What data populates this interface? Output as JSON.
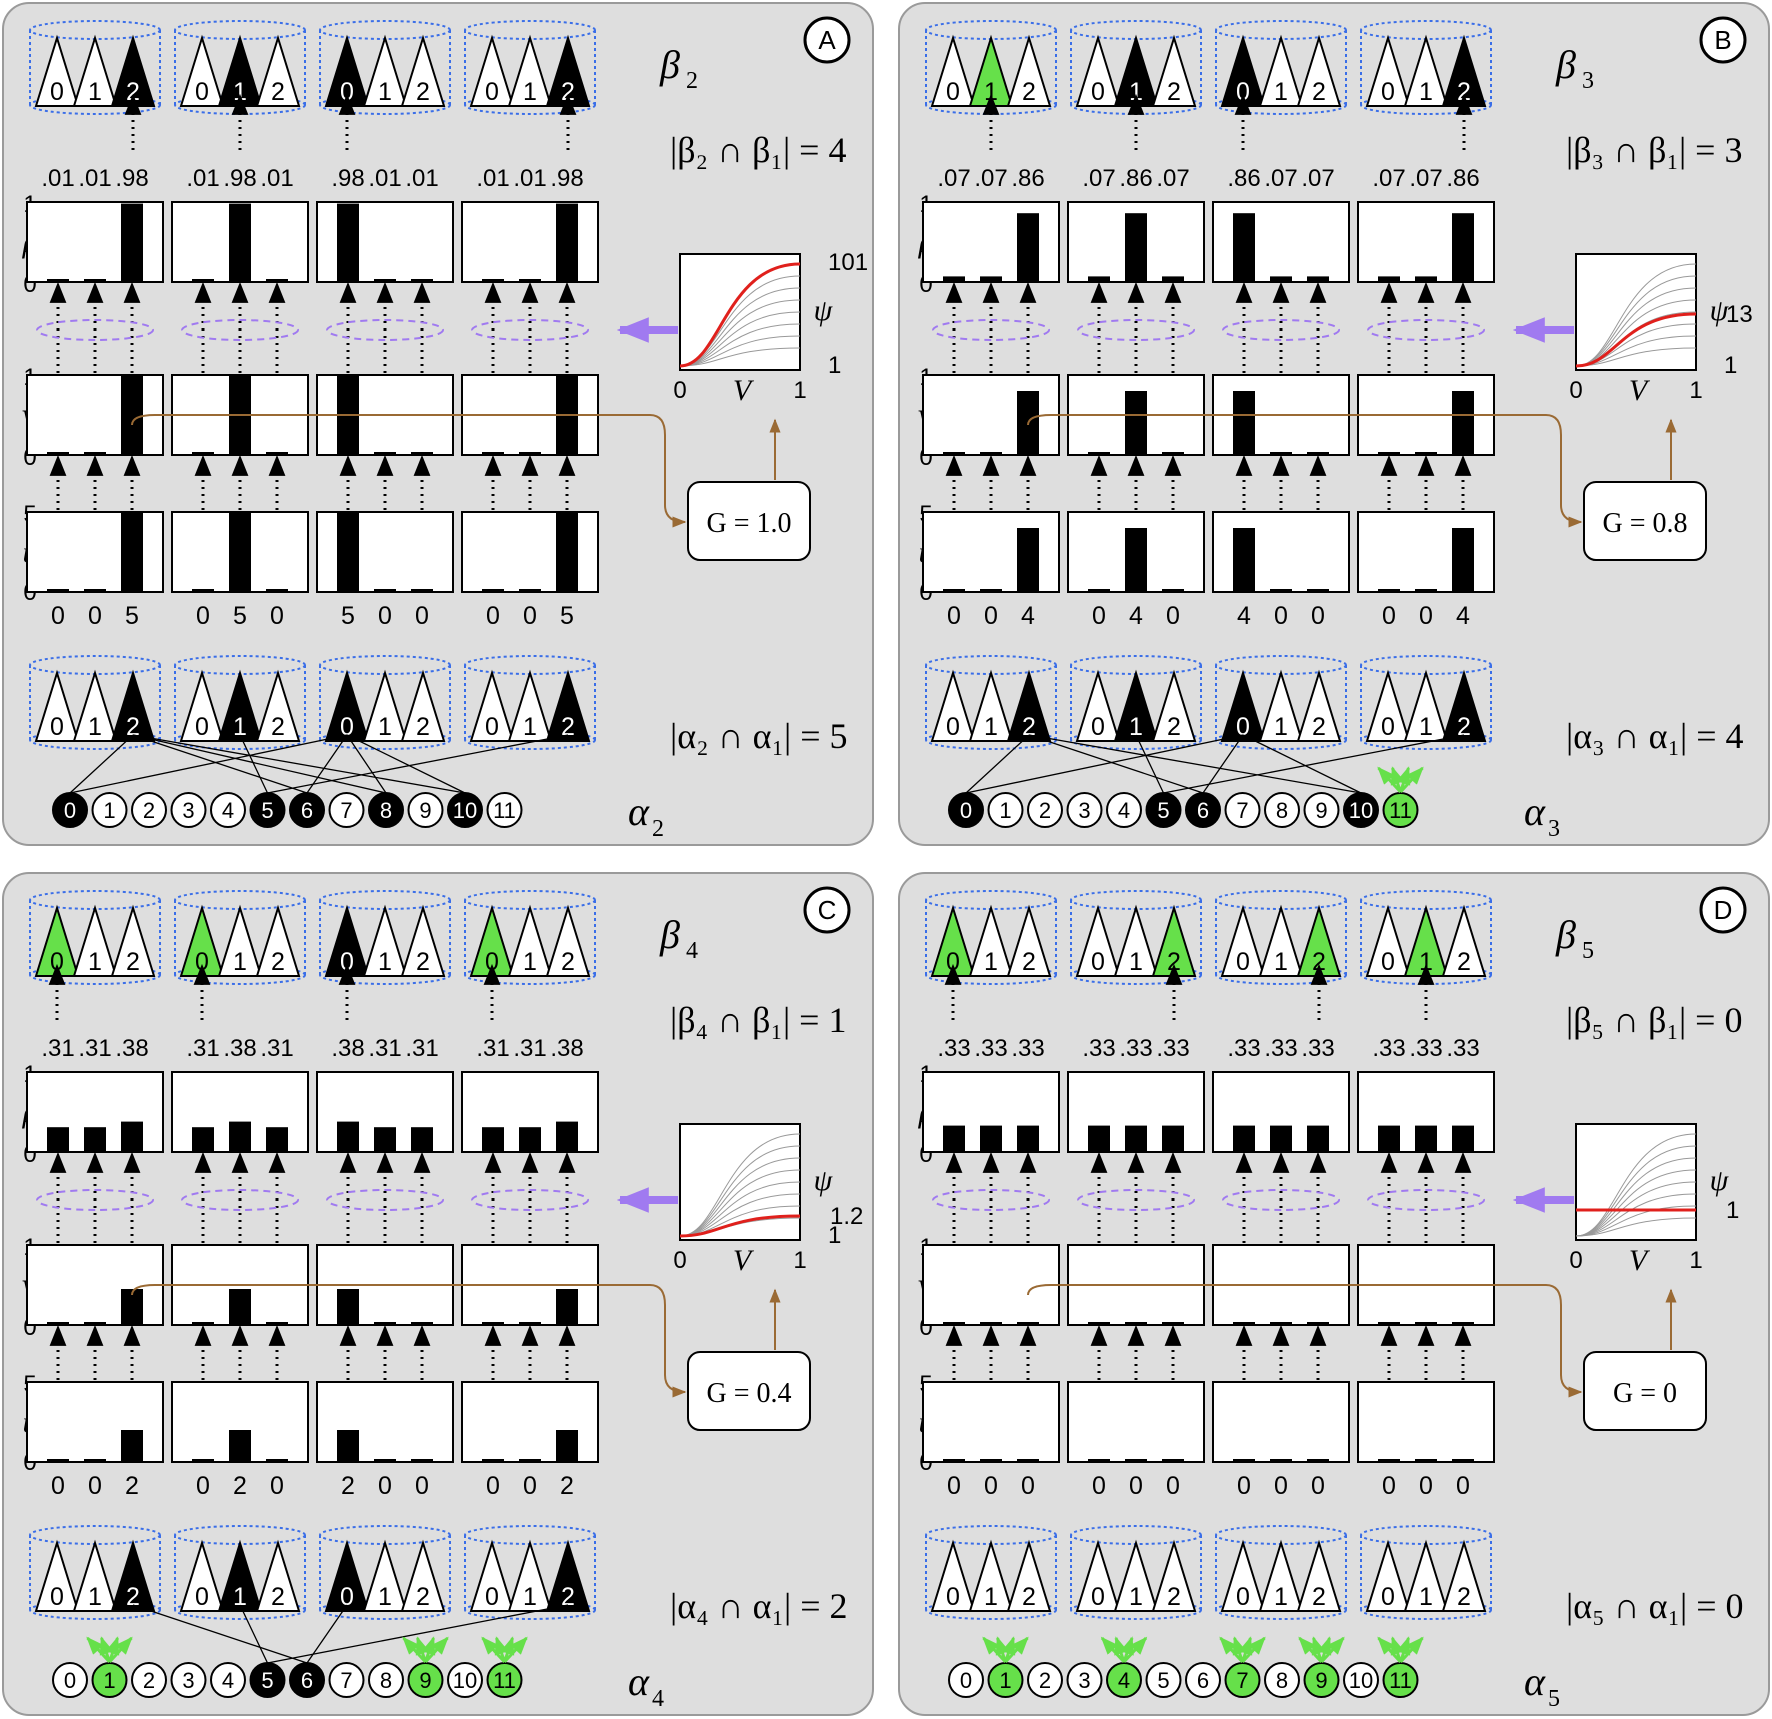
{
  "colors": {
    "panel": "#dedede",
    "green": "#66e04a",
    "purple": "#a07af0",
    "brown": "#9a6a34",
    "blue": "#3a6ee8",
    "red": "#e0201c"
  },
  "axis_labels": {
    "rho": "ρ",
    "V": "V",
    "u": "u",
    "psi": "ψ",
    "x0": "0",
    "x1": "1",
    "t0": "0",
    "t1": "1",
    "t5": "5"
  },
  "neuron_labels": [
    "0",
    "1",
    "2",
    "3",
    "4",
    "5",
    "6",
    "7",
    "8",
    "9",
    "10",
    "11"
  ],
  "triangle_labels": [
    "0",
    "1",
    "2"
  ],
  "panels": [
    {
      "letter": "A",
      "beta_sym": "β",
      "beta_sub": "2",
      "beta_overlap": "|β₂ ∩ β₁| = 4",
      "alpha_sym": "α",
      "alpha_sub": "2",
      "alpha_overlap": "|α₂ ∩ α₁| = 5",
      "G_label": "G = 1.0",
      "psi_top": "101",
      "psi_bottom": "1",
      "psi_mid": "",
      "winners": [
        2,
        1,
        0,
        2
      ],
      "top_green": [
        false,
        false,
        false,
        false
      ],
      "bottom_black": [
        true,
        true,
        true,
        true
      ],
      "rho": [
        [
          0.01,
          0.01,
          0.98
        ],
        [
          0.01,
          0.98,
          0.01
        ],
        [
          0.98,
          0.01,
          0.01
        ],
        [
          0.01,
          0.01,
          0.98
        ]
      ],
      "rho_labels": [
        ".01",
        ".01",
        ".98",
        ".01",
        ".98",
        ".01",
        ".98",
        ".01",
        ".01",
        ".01",
        ".01",
        ".98"
      ],
      "V": [
        [
          0,
          0,
          1.0
        ],
        [
          0,
          1.0,
          0
        ],
        [
          1.0,
          0,
          0
        ],
        [
          0,
          0,
          1.0
        ]
      ],
      "u": [
        [
          0,
          0,
          5
        ],
        [
          0,
          5,
          0
        ],
        [
          5,
          0,
          0
        ],
        [
          0,
          0,
          5
        ]
      ],
      "u_labels": [
        "0",
        "0",
        "5",
        "0",
        "5",
        "0",
        "5",
        "0",
        "0",
        "0",
        "0",
        "5"
      ],
      "black_neurons": [
        0,
        5,
        6,
        8,
        10
      ],
      "green_neurons": []
    },
    {
      "letter": "B",
      "beta_sym": "β",
      "beta_sub": "3",
      "beta_overlap": "|β₃ ∩ β₁| = 3",
      "alpha_sym": "α",
      "alpha_sub": "3",
      "alpha_overlap": "|α₃ ∩ α₁| = 4",
      "G_label": "G = 0.8",
      "psi_top": "",
      "psi_bottom": "1",
      "psi_mid": "13",
      "winners": [
        1,
        1,
        0,
        2
      ],
      "top_green": [
        true,
        false,
        false,
        false
      ],
      "bottom_black": [
        true,
        true,
        true,
        true
      ],
      "rho": [
        [
          0.07,
          0.07,
          0.86
        ],
        [
          0.07,
          0.86,
          0.07
        ],
        [
          0.86,
          0.07,
          0.07
        ],
        [
          0.07,
          0.07,
          0.86
        ]
      ],
      "rho_labels": [
        ".07",
        ".07",
        ".86",
        ".07",
        ".86",
        ".07",
        ".86",
        ".07",
        ".07",
        ".07",
        ".07",
        ".86"
      ],
      "V": [
        [
          0,
          0,
          0.8
        ],
        [
          0,
          0.8,
          0
        ],
        [
          0.8,
          0,
          0
        ],
        [
          0,
          0,
          0.8
        ]
      ],
      "u": [
        [
          0,
          0,
          4
        ],
        [
          0,
          4,
          0
        ],
        [
          4,
          0,
          0
        ],
        [
          0,
          0,
          4
        ]
      ],
      "u_labels": [
        "0",
        "0",
        "4",
        "0",
        "4",
        "0",
        "4",
        "0",
        "0",
        "0",
        "0",
        "4"
      ],
      "black_neurons": [
        0,
        5,
        6,
        10
      ],
      "green_neurons": [
        11
      ]
    },
    {
      "letter": "C",
      "beta_sym": "β",
      "beta_sub": "4",
      "beta_overlap": "|β₄ ∩ β₁| = 1",
      "alpha_sym": "α",
      "alpha_sub": "4",
      "alpha_overlap": "|α₄ ∩ α₁| = 2",
      "G_label": "G = 0.4",
      "psi_top": "",
      "psi_bottom": "1",
      "psi_mid": "1.2",
      "winners": [
        0,
        0,
        0,
        0
      ],
      "top_green": [
        true,
        true,
        false,
        true
      ],
      "bottom_black": [
        true,
        true,
        true,
        true
      ],
      "rho": [
        [
          0.31,
          0.31,
          0.38
        ],
        [
          0.31,
          0.38,
          0.31
        ],
        [
          0.38,
          0.31,
          0.31
        ],
        [
          0.31,
          0.31,
          0.38
        ]
      ],
      "rho_labels": [
        ".31",
        ".31",
        ".38",
        ".31",
        ".38",
        ".31",
        ".38",
        ".31",
        ".31",
        ".31",
        ".31",
        ".38"
      ],
      "V": [
        [
          0,
          0,
          0.45
        ],
        [
          0,
          0.45,
          0
        ],
        [
          0.45,
          0,
          0
        ],
        [
          0,
          0,
          0.45
        ]
      ],
      "u": [
        [
          0,
          0,
          2
        ],
        [
          0,
          2,
          0
        ],
        [
          2,
          0,
          0
        ],
        [
          0,
          0,
          2
        ]
      ],
      "u_labels": [
        "0",
        "0",
        "2",
        "0",
        "2",
        "0",
        "2",
        "0",
        "0",
        "0",
        "0",
        "2"
      ],
      "black_neurons": [
        5,
        6
      ],
      "green_neurons": [
        1,
        9,
        11
      ]
    },
    {
      "letter": "D",
      "beta_sym": "β",
      "beta_sub": "5",
      "beta_overlap": "|β₅ ∩ β₁| = 0",
      "alpha_sym": "α",
      "alpha_sub": "5",
      "alpha_overlap": "|α₅ ∩ α₁| = 0",
      "G_label": "G = 0",
      "psi_top": "",
      "psi_bottom": "",
      "psi_mid": "1",
      "winners": [
        0,
        2,
        2,
        1
      ],
      "top_green": [
        true,
        true,
        true,
        true
      ],
      "bottom_black": [
        false,
        false,
        false,
        false
      ],
      "rho": [
        [
          0.33,
          0.33,
          0.33
        ],
        [
          0.33,
          0.33,
          0.33
        ],
        [
          0.33,
          0.33,
          0.33
        ],
        [
          0.33,
          0.33,
          0.33
        ]
      ],
      "rho_labels": [
        ".33",
        ".33",
        ".33",
        ".33",
        ".33",
        ".33",
        ".33",
        ".33",
        ".33",
        ".33",
        ".33",
        ".33"
      ],
      "V": [
        [
          0,
          0,
          0
        ],
        [
          0,
          0,
          0
        ],
        [
          0,
          0,
          0
        ],
        [
          0,
          0,
          0
        ]
      ],
      "u": [
        [
          0,
          0,
          0
        ],
        [
          0,
          0,
          0
        ],
        [
          0,
          0,
          0
        ],
        [
          0,
          0,
          0
        ]
      ],
      "u_labels": [
        "0",
        "0",
        "0",
        "0",
        "0",
        "0",
        "0",
        "0",
        "0",
        "0",
        "0",
        "0"
      ],
      "black_neurons": [],
      "green_neurons": [
        1,
        4,
        7,
        9,
        11
      ]
    }
  ]
}
